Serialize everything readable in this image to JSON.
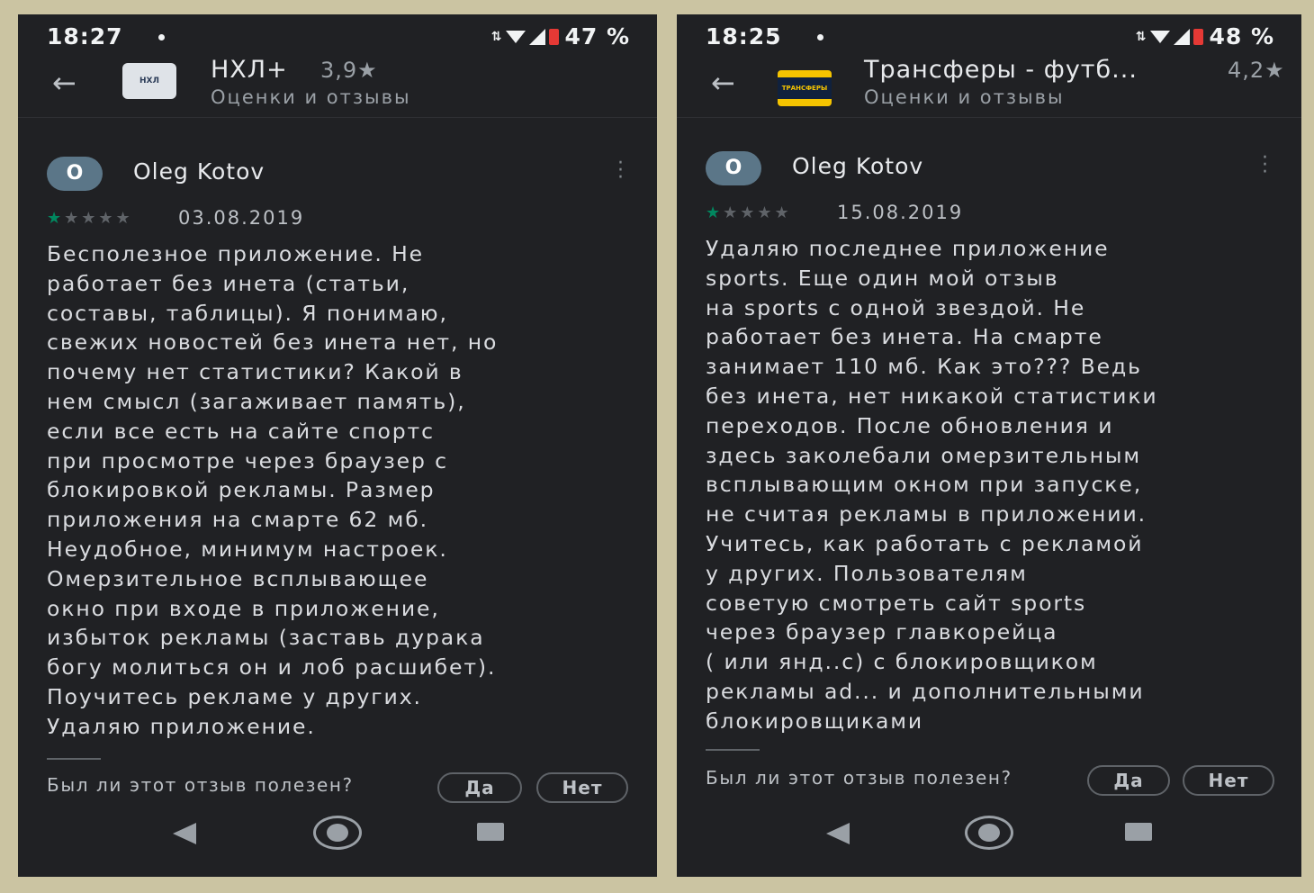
{
  "screens": [
    {
      "status": {
        "time": "18:27",
        "battery": "47 %"
      },
      "header": {
        "app_logo_text": "НХЛ",
        "app_name": "НХЛ+",
        "rating": "3,9★",
        "subtitle": "Оценки и отзывы"
      },
      "review": {
        "avatar_letter": "O",
        "author": "Oleg Kotov",
        "stars_filled": "★",
        "stars_empty": "★★★★",
        "rating_value": 1,
        "date": "03.08.2019",
        "text": "Бесполезное приложение. Не\nработает без инета (статьи,\nсоставы, таблицы). Я понимаю,\nсвежих новостей без инета нет, но\nпочему нет статистики? Какой в\nнем смысл (загаживает память),\nесли все есть на сайте спортс\nпри просмотре через браузер с\nблокировкой рекламы. Размер\nприложения на смарте 62 мб.\nНеудобное, минимум настроек.\nОмерзительное всплывающее\nокно при входе в приложение,\nизбыток рекламы (заставь дурака\nбогу молиться он и лоб расшибет).\nПоучитесь рекламе у других.\nУдаляю приложение.",
        "helpful_question": "Был ли этот отзыв полезен?",
        "yes_label": "Да",
        "no_label": "Нет"
      }
    },
    {
      "status": {
        "time": "18:25",
        "battery": "48 %"
      },
      "header": {
        "app_logo_text": "ТРАНСФЕРЫ",
        "app_name": "Трансферы - футб...",
        "rating": "4,2★",
        "subtitle": "Оценки и отзывы"
      },
      "review": {
        "avatar_letter": "O",
        "author": "Oleg Kotov",
        "stars_filled": "★",
        "stars_empty": "★★★★",
        "rating_value": 1,
        "date": "15.08.2019",
        "text": "Удаляю последнее приложение\nsports. Еще один мой отзыв\nна sports с одной звездой. Не\nработает без инета. На смарте\nзанимает 110 мб. Как это??? Ведь\nбез инета, нет никакой статистики\nпереходов. После обновления и\nздесь заколебали омерзительным\nвсплывающим окном при запуске,\nне считая рекламы в приложении.\nУчитесь, как работать с рекламой\nу других. Пользователям\nсоветую смотреть сайт sports\nчерез браузер главкорейца\n( или янд..с) с блокировщиком\nрекламы ad... и дополнительными\nблокировщиками",
        "helpful_question": "Был ли этот отзыв полезен?",
        "yes_label": "Да",
        "no_label": "Нет"
      }
    }
  ],
  "colors": {
    "background": "#cbc4a2",
    "screen": "#202124",
    "star_filled": "#01875f",
    "avatar": "#5b7688"
  }
}
